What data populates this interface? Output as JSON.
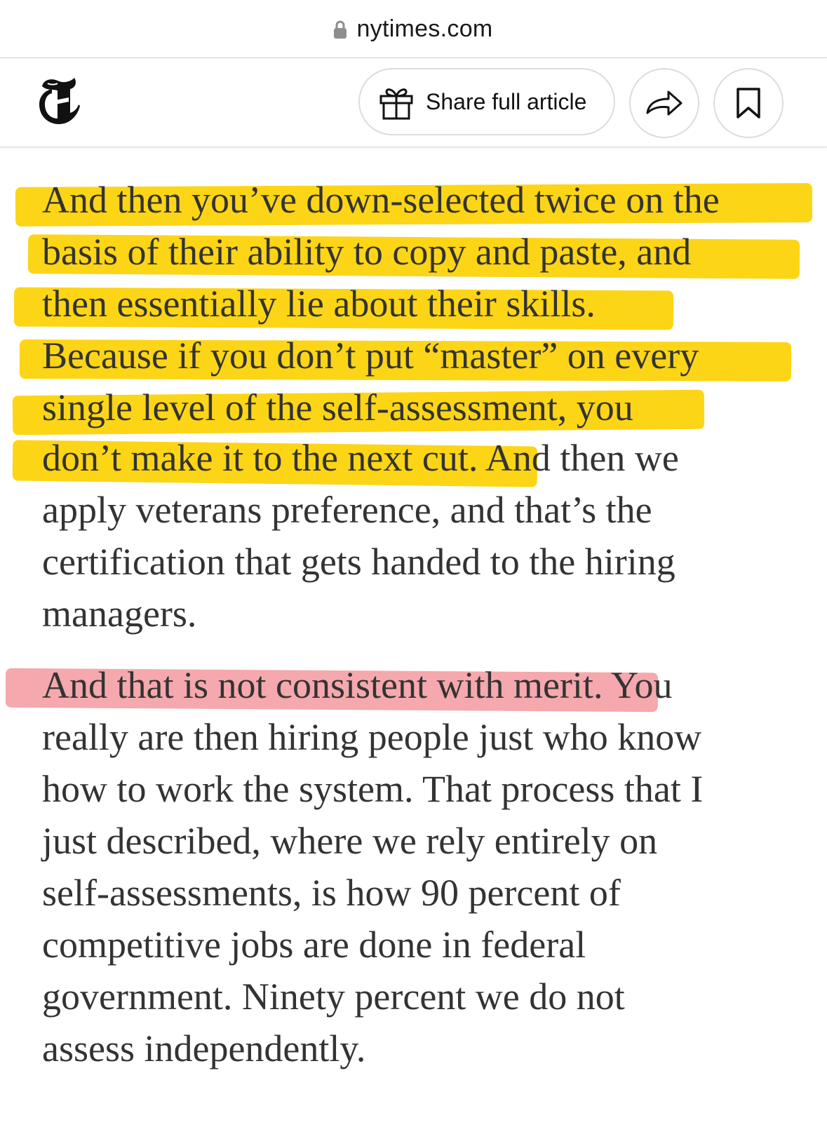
{
  "browser": {
    "url_domain": "nytimes.com",
    "lock_icon": "lock-icon"
  },
  "header": {
    "logo": "nyt-t-logo",
    "share_full_label": "Share full article",
    "gift_icon": "gift-icon",
    "share_icon": "share-arrow-icon",
    "bookmark_icon": "bookmark-icon"
  },
  "highlight_colors": {
    "yellow": "#fcd516",
    "pink": "#f5a8ad"
  },
  "article": {
    "paragraph1": {
      "lines": [
        "And then you’ve down-selected twice on the",
        "basis of their ability to copy and paste, and",
        "then essentially lie about their skills.",
        "Because if you don’t put “master” on every",
        "single level of the self-assessment, you",
        "don’t make it to the next cut.",
        "apply veterans preference, and that’s the",
        "certification that gets handed to the hiring",
        "managers."
      ],
      "line6_tail": " And then we"
    },
    "paragraph2": {
      "highlighted": "And that is not consistent with merit",
      "first_line_tail": ". You",
      "lines": [
        "really are then hiring people just who know",
        "how to work the system. That process that I",
        "just described, where we rely entirely on",
        "self-assessments, is how 90 percent of",
        "competitive jobs are done in federal",
        "government. Ninety percent we do not",
        "assess independently."
      ]
    }
  }
}
